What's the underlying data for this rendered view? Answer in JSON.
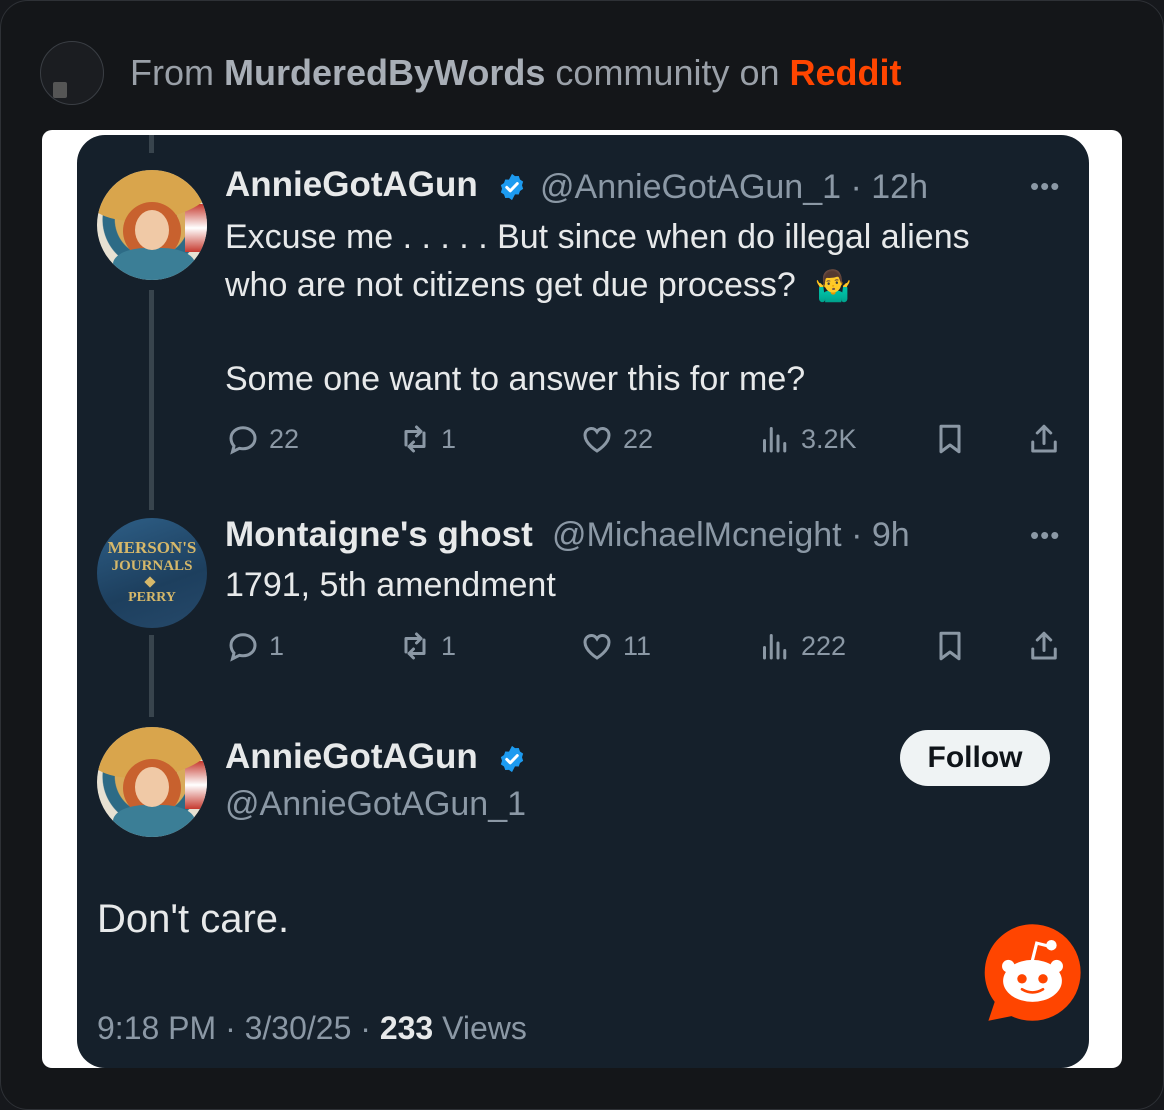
{
  "header": {
    "prefix": "From",
    "community": "MurderedByWords",
    "middle": "community on",
    "platform": "Reddit"
  },
  "tweets": [
    {
      "display_name": "AnnieGotAGun",
      "handle_time": "@AnnieGotAGun_1 · 12h",
      "lines": [
        "Excuse me . . . . . But since when do illegal aliens",
        "who are not citizens get due process?",
        "Some one want to answer this for me?"
      ],
      "emoji": "🤷‍♂️",
      "replies": "22",
      "reposts": "1",
      "likes": "22",
      "views": "3.2K"
    },
    {
      "display_name": "Montaigne's ghost",
      "handle_time": "@MichaelMcneight · 9h",
      "avatar_text": [
        "MERSON'S",
        "JOURNALS",
        "PERRY"
      ],
      "lines": [
        "1791, 5th amendment"
      ],
      "replies": "1",
      "reposts": "1",
      "likes": "11",
      "views": "222"
    }
  ],
  "main_tweet": {
    "display_name": "AnnieGotAGun",
    "handle": "@AnnieGotAGun_1",
    "follow_label": "Follow",
    "text": "Don't care.",
    "time": "9:18 PM · 3/30/25 · ",
    "views_count": "233",
    "views_label": " Views"
  },
  "colors": {
    "card_bg": "#15202b",
    "verified": "#1d9bf0",
    "reddit": "#ff4500"
  }
}
